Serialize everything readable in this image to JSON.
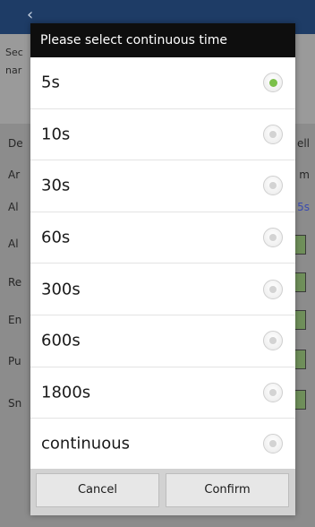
{
  "background": {
    "back_glyph": "‹",
    "section_label_1": "Sec",
    "section_label_2": "nar",
    "rows": [
      {
        "label": "De",
        "right": "ell",
        "right_type": "text"
      },
      {
        "label": "Ar",
        "right": "m",
        "right_type": "text"
      },
      {
        "label": "Al",
        "right": "5s",
        "right_type": "link"
      },
      {
        "label": "Al",
        "right": "",
        "right_type": "toggle"
      },
      {
        "label": "Re",
        "right": "",
        "right_type": "toggle"
      },
      {
        "label": "En",
        "right": "",
        "right_type": "toggle"
      },
      {
        "label": "Pu",
        "right": "",
        "right_type": "toggle"
      },
      {
        "label": "Sn",
        "right": "",
        "right_type": "toggle"
      }
    ]
  },
  "dialog": {
    "title": "Please select continuous time",
    "options": [
      {
        "label": "5s",
        "selected": true
      },
      {
        "label": "10s",
        "selected": false
      },
      {
        "label": "30s",
        "selected": false
      },
      {
        "label": "60s",
        "selected": false
      },
      {
        "label": "300s",
        "selected": false
      },
      {
        "label": "600s",
        "selected": false
      },
      {
        "label": "1800s",
        "selected": false
      },
      {
        "label": "continuous",
        "selected": false
      }
    ],
    "cancel_label": "Cancel",
    "confirm_label": "Confirm"
  },
  "colors": {
    "header_blue": "#1e3c66",
    "selected_green": "#7bc04a",
    "title_bar": "#0e0e0e",
    "link_blue": "#3a4bb0"
  }
}
